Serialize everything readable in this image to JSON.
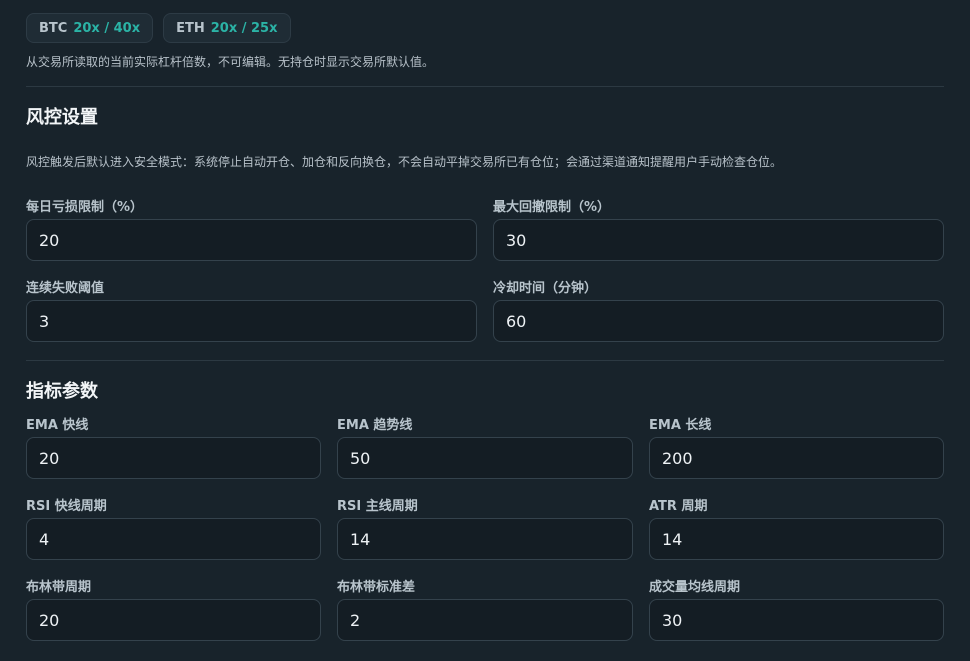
{
  "leverage": {
    "items": [
      {
        "symbol": "BTC",
        "value": "20x / 40x"
      },
      {
        "symbol": "ETH",
        "value": "20x / 25x"
      }
    ],
    "note": "从交易所读取的当前实际杠杆倍数，不可编辑。无持仓时显示交易所默认值。"
  },
  "risk": {
    "title": "风控设置",
    "description": "风控触发后默认进入安全模式：系统停止自动开仓、加仓和反向换仓，不会自动平掉交易所已有仓位；会通过渠道通知提醒用户手动检查仓位。",
    "daily_loss_label": "每日亏损限制（%）",
    "daily_loss_value": "20",
    "max_drawdown_label": "最大回撤限制（%）",
    "max_drawdown_value": "30",
    "consecutive_fail_label": "连续失败阈值",
    "consecutive_fail_value": "3",
    "cooldown_label": "冷却时间（分钟）",
    "cooldown_value": "60"
  },
  "indicators": {
    "title": "指标参数",
    "ema_fast_label": "EMA 快线",
    "ema_fast_value": "20",
    "ema_trend_label": "EMA 趋势线",
    "ema_trend_value": "50",
    "ema_long_label": "EMA 长线",
    "ema_long_value": "200",
    "rsi_fast_label": "RSI 快线周期",
    "rsi_fast_value": "4",
    "rsi_main_label": "RSI 主线周期",
    "rsi_main_value": "14",
    "atr_label": "ATR 周期",
    "atr_value": "14",
    "boll_period_label": "布林带周期",
    "boll_period_value": "20",
    "boll_std_label": "布林带标准差",
    "boll_std_value": "2",
    "vol_ma_label": "成交量均线周期",
    "vol_ma_value": "30"
  }
}
